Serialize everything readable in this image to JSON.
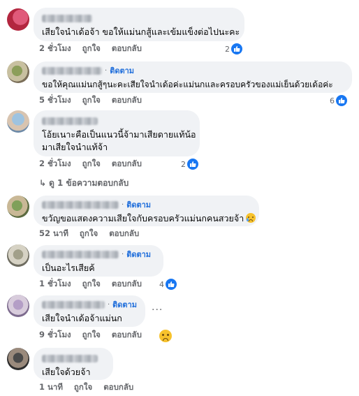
{
  "comments": [
    {
      "text_lines": [
        "เสียใจนำเด้อจ้า ขอให้แม่นกสู้และเข้มแข็งต่อไปนะคะ"
      ],
      "follow": "",
      "time": "2 ชั่วโมง",
      "like_label": "ถูกใจ",
      "reply_label": "ตอบกลับ",
      "reaction_count": "2"
    },
    {
      "text_lines": [
        "ขอให้คุณแม่นกสู้ๆนะคะเสียใจนำเด้อค่ะแม่นกและครอบครัวของแม่เย็นด้วยเด้อค่ะ"
      ],
      "follow": "ติดตาม",
      "time": "5 ชั่วโมง",
      "like_label": "ถูกใจ",
      "reply_label": "ตอบกลับ",
      "reaction_count": "6"
    },
    {
      "text_lines": [
        "โอ้ยเนาะคือเป็นแนวนี้จ้ามาเสียดายแท้น้อ",
        "มาเสียใจนำแท้จ้า"
      ],
      "follow": "",
      "time": "2 ชั่วโมง",
      "like_label": "ถูกใจ",
      "reply_label": "ตอบกลับ",
      "reaction_count": "2",
      "replies_label": "ดู 1 ข้อความตอบกลับ"
    },
    {
      "text_lines": [
        "ขวัญขอแสดงความเสียใจกับครอบครัวแม่นกคนสวยจ้า"
      ],
      "follow": "ติดตาม",
      "time": "52 นาที",
      "like_label": "ถูกใจ",
      "reply_label": "ตอบกลับ",
      "reaction_count": ""
    },
    {
      "text_lines": [
        "เป็นอะไรเสียค้"
      ],
      "follow": "ติดตาม",
      "time": "1 ชั่วโมง",
      "like_label": "ถูกใจ",
      "reply_label": "ตอบกลับ",
      "reaction_count": "4"
    },
    {
      "text_lines": [
        "เสียใจนำเด้อจ้าแม่นก"
      ],
      "follow": "ติดตาม",
      "time": "9 ชั่วโมง",
      "like_label": "ถูกใจ",
      "reply_label": "ตอบกลับ",
      "reaction_count": ""
    },
    {
      "text_lines": [
        "เสียใจด้วยจ้า"
      ],
      "follow": "",
      "time": "1 นาที",
      "like_label": "ถูกใจ",
      "reply_label": "ตอบกลับ",
      "reaction_count": ""
    }
  ],
  "colors": {
    "link_blue": "#216fdb",
    "like_blue": "#1877f2",
    "bubble_bg": "#f0f2f5",
    "meta_gray": "#65676b"
  },
  "icons": {
    "reaction": "thumbs-up-icon",
    "sticker": "sad-face-icon",
    "emoji_inline": "crying-face-icon",
    "menu": "more-dots-icon"
  },
  "more_menu": "···"
}
